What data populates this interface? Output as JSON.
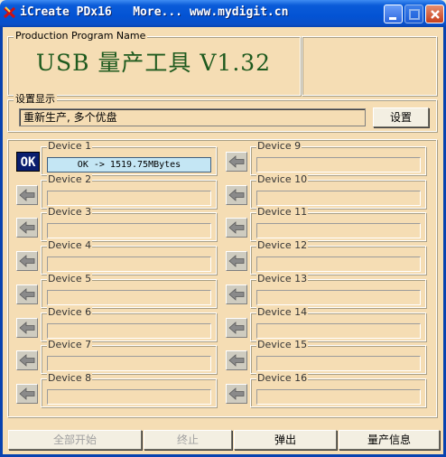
{
  "window": {
    "title": "iCreate PDx16   More... www.mydigit.cn"
  },
  "program_group": {
    "label": "Production Program Name",
    "name": "USB 量产工具 V1.32"
  },
  "settings": {
    "label": "设置显示",
    "value": "重新生产, 多个优盘",
    "button": "设置"
  },
  "devices": [
    {
      "label": "Device 1",
      "status": "OK -> 1519.75MBytes",
      "state": "OK"
    },
    {
      "label": "Device 2",
      "status": ""
    },
    {
      "label": "Device 3",
      "status": ""
    },
    {
      "label": "Device 4",
      "status": ""
    },
    {
      "label": "Device 5",
      "status": ""
    },
    {
      "label": "Device 6",
      "status": ""
    },
    {
      "label": "Device 7",
      "status": ""
    },
    {
      "label": "Device 8",
      "status": ""
    },
    {
      "label": "Device 9",
      "status": ""
    },
    {
      "label": "Device 10",
      "status": ""
    },
    {
      "label": "Device 11",
      "status": ""
    },
    {
      "label": "Device 12",
      "status": ""
    },
    {
      "label": "Device 13",
      "status": ""
    },
    {
      "label": "Device 14",
      "status": ""
    },
    {
      "label": "Device 15",
      "status": ""
    },
    {
      "label": "Device 16",
      "status": ""
    }
  ],
  "bottom": {
    "start_all": "全部开始",
    "stop": "终止",
    "eject": "弹出",
    "info": "量产信息"
  }
}
